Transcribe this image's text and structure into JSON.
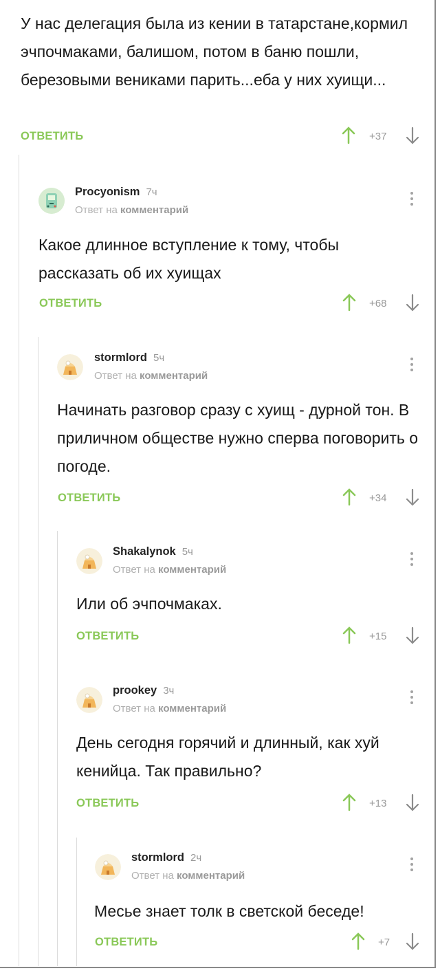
{
  "ui": {
    "reply_label": "ОТВЕТИТЬ",
    "reply_to_prefix": "Ответ на",
    "reply_to_link": "комментарий"
  },
  "comments": [
    {
      "author": "",
      "ago": "",
      "text": "У нас делегация была из кении в татарстане,кормил эчпочмаками, балишом, потом в баню пошли, березовыми вениками парить...еба у них хуищи...",
      "score": "+37"
    },
    {
      "author": "Procyonism",
      "ago": "7ч",
      "text": "Какое длинное вступление к тому, чтобы рассказать об их хуищах",
      "score": "+68"
    },
    {
      "author": "stormlord",
      "ago": "5ч",
      "text": "Начинать разговор сразу с хуищ - дурной тон. В приличном обществе нужно сперва поговорить о погоде.",
      "score": "+34"
    },
    {
      "author": "Shakalynok",
      "ago": "5ч",
      "text": "Или об эчпочмаках.",
      "score": "+15"
    },
    {
      "author": "prookey",
      "ago": "3ч",
      "text": "День сегодня горячий и длинный, как хуй кенийца. Так правильно?",
      "score": "+13"
    },
    {
      "author": "stormlord",
      "ago": "2ч",
      "text": "Месье знает толк в светской беседе!",
      "score": "+7"
    }
  ]
}
